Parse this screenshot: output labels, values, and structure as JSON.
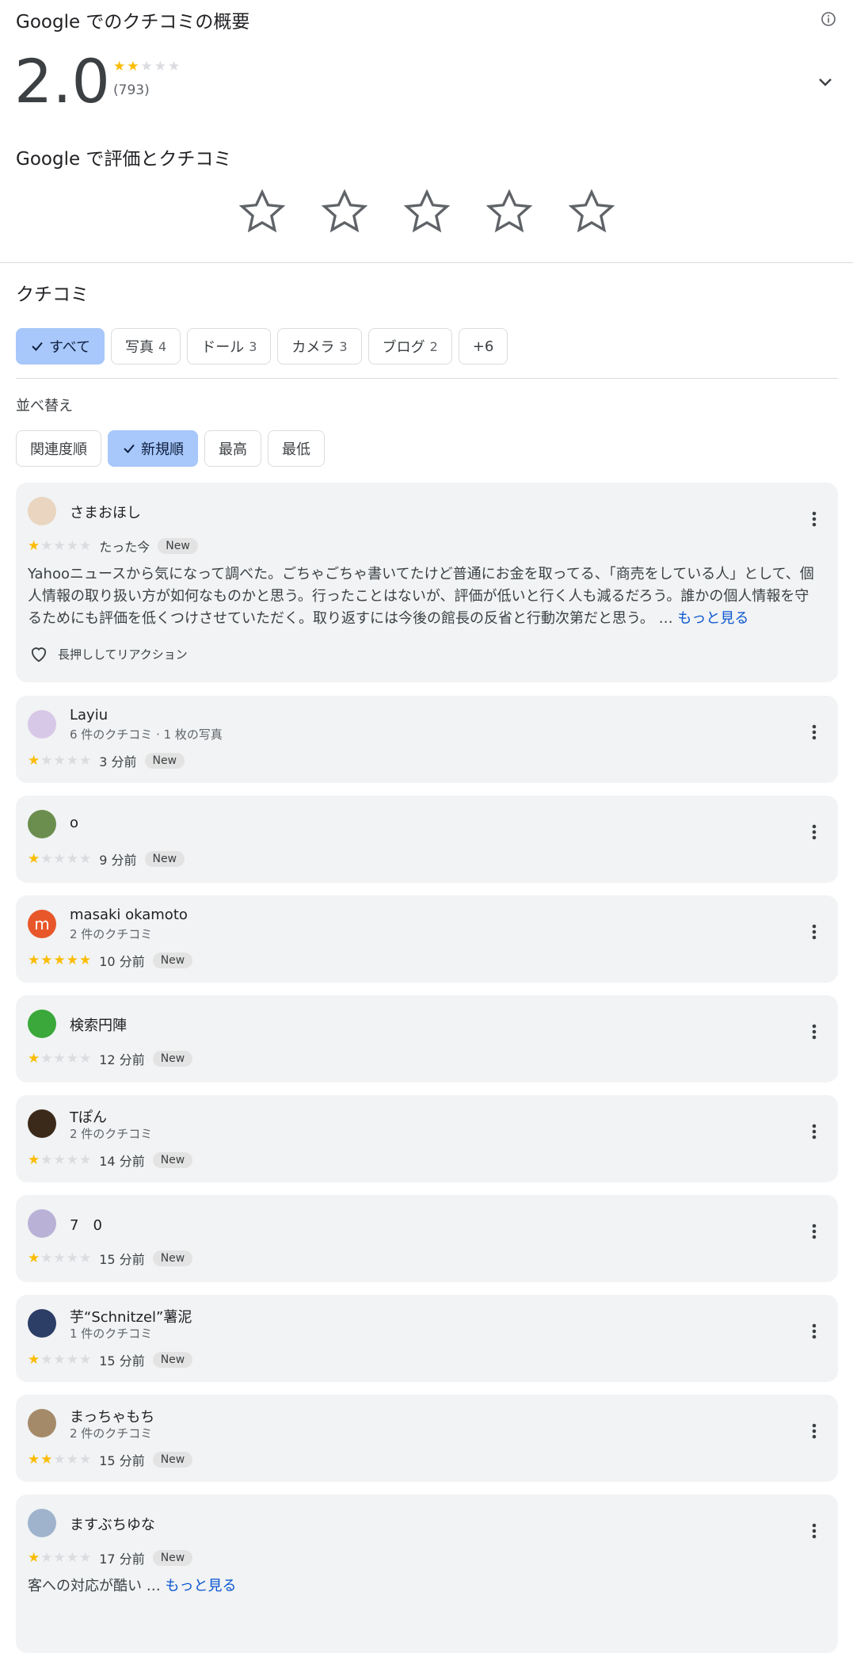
{
  "summary": {
    "title": "Google でのクチコミの概要",
    "score": "2.0",
    "rating": 2,
    "count": "(793)"
  },
  "rate": {
    "title": "Google で評価とクチコミ"
  },
  "reviews_section": {
    "title": "クチコミ"
  },
  "filters": [
    {
      "label": "すべて",
      "num": "",
      "selected": true
    },
    {
      "label": "写真",
      "num": "4",
      "selected": false
    },
    {
      "label": "ドール",
      "num": "3",
      "selected": false
    },
    {
      "label": "カメラ",
      "num": "3",
      "selected": false
    },
    {
      "label": "ブログ",
      "num": "2",
      "selected": false
    },
    {
      "label": "+6",
      "num": "",
      "selected": false
    }
  ],
  "sort": {
    "label": "並べ替え",
    "options": [
      {
        "label": "関連度順",
        "selected": false
      },
      {
        "label": "新規順",
        "selected": true
      },
      {
        "label": "最高",
        "selected": false
      },
      {
        "label": "最低",
        "selected": false
      }
    ]
  },
  "reviews": [
    {
      "name": "さまおほし",
      "sub": "",
      "stars": 1,
      "time": "たった今",
      "badge": "New",
      "text": "Yahooニュースから気になって調べた。ごちゃごちゃ書いてたけど普通にお金を取ってる、「商売をしている人」として、個人情報の取り扱い方が如何なものかと思う。行ったことはないが、評価が低いと行く人も減るだろう。誰かの個人情報を守るためにも評価を低くつけさせていただく。取り返すには今後の館長の反省と行動次第だと思う。 … ",
      "more": "もっと見る",
      "reaction": "長押ししてリアクション",
      "avatar_color": "#e9d5c0"
    },
    {
      "name": "Layiu",
      "sub": "6 件のクチコミ · 1 枚の写真",
      "stars": 1,
      "time": "3 分前",
      "badge": "New",
      "avatar_color": "#d8c8e8"
    },
    {
      "name": "o",
      "sub": "",
      "stars": 1,
      "time": "9 分前",
      "badge": "New",
      "avatar_color": "#6b8e4e"
    },
    {
      "name": "masaki okamoto",
      "sub": "2 件のクチコミ",
      "stars": 5,
      "time": "10 分前",
      "badge": "New",
      "avatar_color": "#e8572a",
      "avatar_letter": "m"
    },
    {
      "name": "検索円陣",
      "sub": "",
      "stars": 1,
      "time": "12 分前",
      "badge": "New",
      "avatar_color": "#3aa83a"
    },
    {
      "name": "Tぽん",
      "sub": "2 件のクチコミ",
      "stars": 1,
      "time": "14 分前",
      "badge": "New",
      "avatar_color": "#3b2a1a"
    },
    {
      "name": "7　0",
      "sub": "",
      "stars": 1,
      "time": "15 分前",
      "badge": "New",
      "avatar_color": "#b9b2d6"
    },
    {
      "name": "芋“Schnitzel”薯泥",
      "sub": "1 件のクチコミ",
      "stars": 1,
      "time": "15 分前",
      "badge": "New",
      "avatar_color": "#2c3e66"
    },
    {
      "name": "まっちゃもち",
      "sub": "2 件のクチコミ",
      "stars": 2,
      "time": "15 分前",
      "badge": "New",
      "avatar_color": "#a58a6a"
    },
    {
      "name": "ますぶちゆな",
      "sub": "",
      "stars": 1,
      "time": "17 分前",
      "badge": "New",
      "text": "客への対応が酷い … ",
      "more": "もっと見る",
      "avatar_color": "#9fb3cc"
    }
  ],
  "colors": {
    "star": "#fbbc04",
    "star_empty": "#dadce0",
    "chip_selected": "#a8c7fa",
    "link": "#0b57d0",
    "card_bg": "#f1f3f4"
  }
}
